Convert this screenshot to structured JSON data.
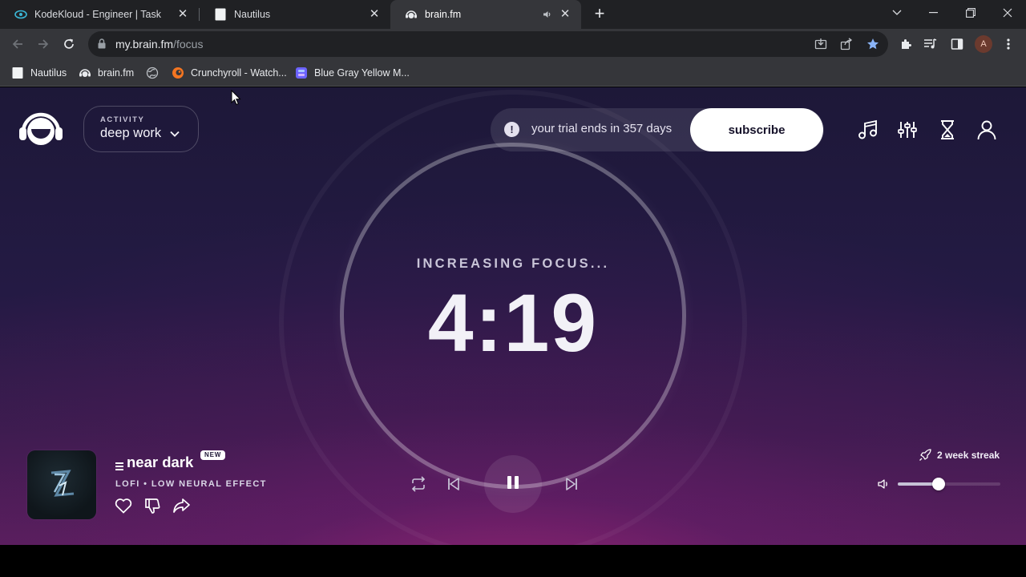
{
  "browser": {
    "tabs": [
      {
        "title": "KodeKloud - Engineer | Task",
        "icon": "kodekloud-favicon",
        "active": false
      },
      {
        "title": "Nautilus",
        "icon": "blank-page-favicon",
        "active": false
      },
      {
        "title": "brain.fm",
        "icon": "brainfm-favicon",
        "active": true,
        "muted_icon": "speaker-icon"
      }
    ],
    "close_glyph": "✕",
    "new_tab_glyph": "+",
    "url": {
      "host": "my.brain.fm",
      "path": "/focus"
    },
    "profile_initial": "A",
    "bookmarks": [
      {
        "label": "Nautilus",
        "icon": "blank-page-favicon"
      },
      {
        "label": "brain.fm",
        "icon": "brainfm-favicon"
      },
      {
        "label": "",
        "icon": "globe-icon"
      },
      {
        "label": "Crunchyroll - Watch...",
        "icon": "crunchyroll-favicon"
      },
      {
        "label": "Blue Gray Yellow M...",
        "icon": "palette-favicon"
      }
    ]
  },
  "app": {
    "activity": {
      "label": "ACTIVITY",
      "value": "deep work"
    },
    "trial": {
      "alert_glyph": "!",
      "text": "your trial ends in 357 days",
      "button": "subscribe"
    },
    "top_icons": [
      "music-note-icon",
      "sliders-icon",
      "hourglass-icon",
      "user-icon"
    ],
    "status": "INCREASING FOCUS...",
    "timer": "4:19",
    "track": {
      "title": "near dark",
      "badge": "NEW",
      "genre": "LOFI • LOW NEURAL EFFECT"
    },
    "track_actions": [
      "heart-icon",
      "thumbs-down-icon",
      "share-icon"
    ],
    "controls": [
      "repeat-icon",
      "skip-previous-icon",
      "pause-icon",
      "skip-next-icon"
    ],
    "streak": "2 week streak",
    "volume": {
      "level": 0.4
    },
    "colors": {
      "accent_white": "#ffffff",
      "background_top": "#1d1838",
      "background_glow": "#a52878"
    }
  }
}
